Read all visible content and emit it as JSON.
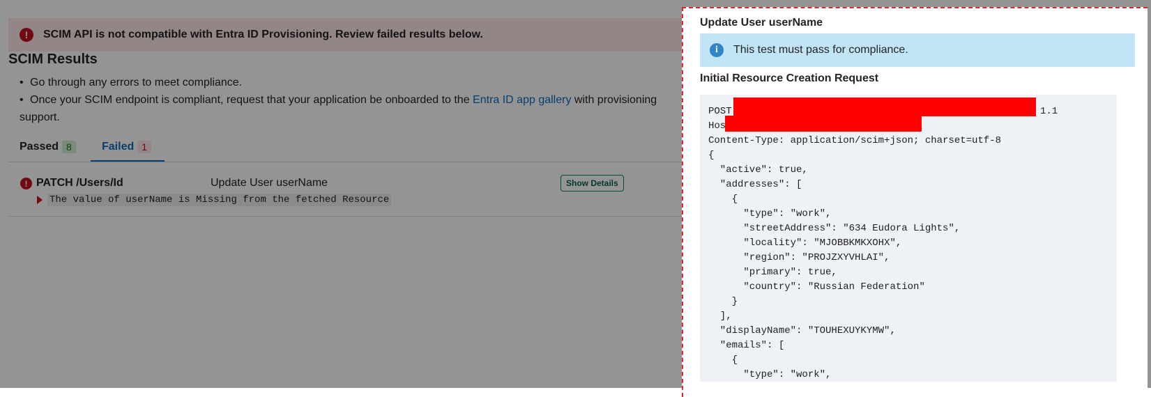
{
  "banner": {
    "message": "SCIM API is not compatible with Entra ID Provisioning. Review failed results below."
  },
  "results": {
    "title": "SCIM Results",
    "guidance": {
      "line1": "Go through any errors to meet compliance.",
      "line2_before_link": "Once your SCIM endpoint is compliant, request that your application be onboarded to the ",
      "line2_link": "Entra ID app gallery",
      "line2_after_link": " with provisioning",
      "line2_continuation": "support."
    },
    "tabs": [
      {
        "label": "Passed",
        "count": "8"
      },
      {
        "label": "Failed",
        "count": "1"
      }
    ],
    "rows": [
      {
        "endpoint": "PATCH /Users/Id",
        "name": "Update User userName",
        "action": "Show Details",
        "message": "The value of userName is Missing from the fetched Resource"
      }
    ]
  },
  "panel": {
    "title": "Update User userName",
    "info": "This test must pass for compliance.",
    "section_heading": "Initial Resource Creation Request",
    "request_method": "POST",
    "http_version_suffix": "1.1",
    "host_label": "Host:",
    "code_body": "Content-Type: application/scim+json; charset=utf-8\n{\n  \"active\": true,\n  \"addresses\": [\n    {\n      \"type\": \"work\",\n      \"streetAddress\": \"634 Eudora Lights\",\n      \"locality\": \"MJOBBKMKXOHX\",\n      \"region\": \"PROJZXYVHLAI\",\n      \"primary\": true,\n      \"country\": \"Russian Federation\"\n    }\n  ],\n  \"displayName\": \"TOUHEXUYKYMW\",\n  \"emails\": [\n    {\n      \"type\": \"work\","
  },
  "colors": {
    "error": "#c50f1f",
    "link": "#0f6cbd",
    "info_bg": "#c2e4f7",
    "redaction": "#ff0000"
  }
}
